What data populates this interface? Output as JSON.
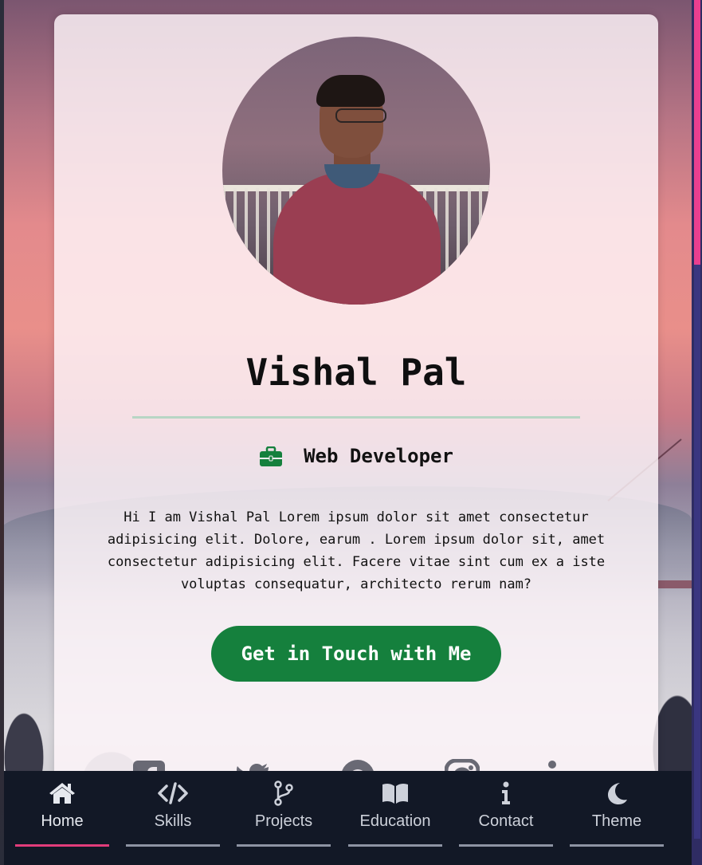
{
  "profile": {
    "name": "Vishal Pal",
    "role": "Web Developer",
    "bio": "Hi I am Vishal Pal Lorem ipsum dolor sit amet consectetur adipisicing elit. Dolore, earum . Lorem ipsum dolor sit, amet consectetur adipisicing elit. Facere vitae sint cum ex a iste voluptas consequatur, architecto rerum nam?",
    "cta_label": "Get in Touch with Me"
  },
  "socials": [
    {
      "icon": "facebook-icon"
    },
    {
      "icon": "twitter-icon"
    },
    {
      "icon": "github-icon"
    },
    {
      "icon": "instagram-icon"
    },
    {
      "icon": "linkedin-icon"
    }
  ],
  "nav": {
    "items": [
      {
        "label": "Home",
        "icon": "home-icon",
        "active": true
      },
      {
        "label": "Skills",
        "icon": "code-icon",
        "active": false
      },
      {
        "label": "Projects",
        "icon": "git-branch-icon",
        "active": false
      },
      {
        "label": "Education",
        "icon": "book-icon",
        "active": false
      },
      {
        "label": "Contact",
        "icon": "info-icon",
        "active": false
      },
      {
        "label": "Theme",
        "icon": "moon-icon",
        "active": false
      }
    ]
  },
  "colors": {
    "accent_green": "#15803d",
    "active_indicator": "#e23c7a",
    "nav_background": "#121826",
    "scrollbar_thumb": "#ea3f8f"
  }
}
